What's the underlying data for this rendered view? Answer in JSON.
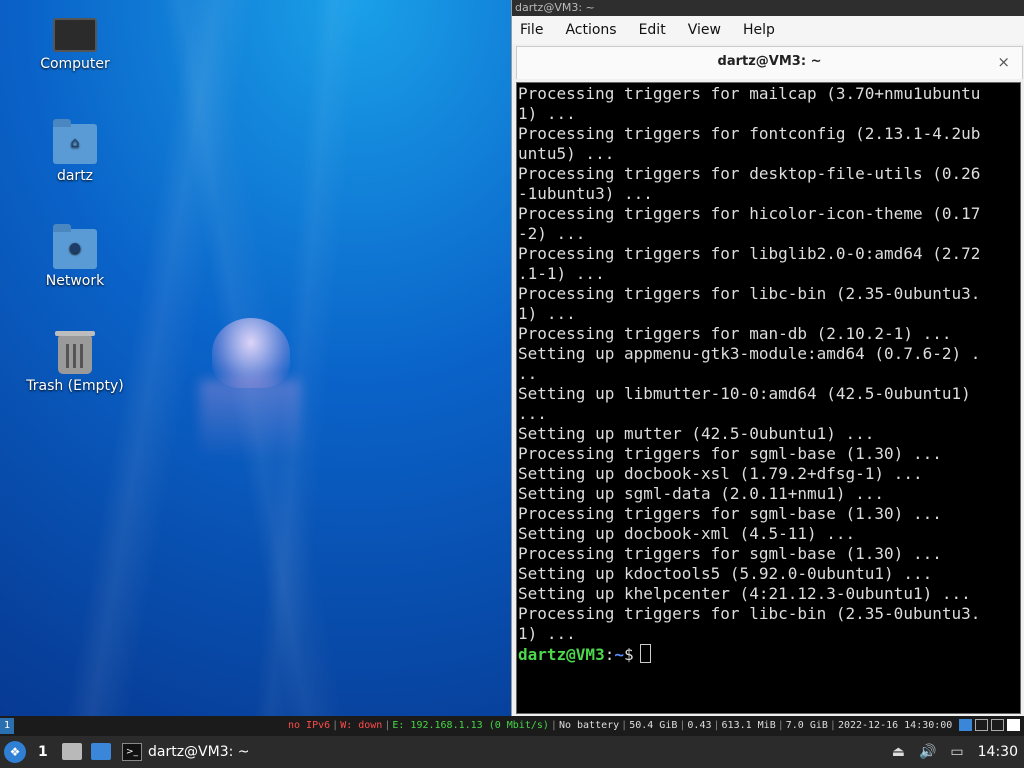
{
  "desktop": {
    "icons": [
      {
        "label": "Computer",
        "icon": "computer-icon"
      },
      {
        "label": "dartz",
        "icon": "home-folder-icon"
      },
      {
        "label": "Network",
        "icon": "network-folder-icon"
      },
      {
        "label": "Trash (Empty)",
        "icon": "trash-icon"
      }
    ]
  },
  "terminal": {
    "window_title": "dartz@VM3: ~",
    "menu": [
      "File",
      "Actions",
      "Edit",
      "View",
      "Help"
    ],
    "tab_title": "dartz@VM3: ~",
    "tab_close": "×",
    "lines": [
      "Processing triggers for mailcap (3.70+nmu1ubuntu",
      "1) ...",
      "Processing triggers for fontconfig (2.13.1-4.2ub",
      "untu5) ...",
      "Processing triggers for desktop-file-utils (0.26",
      "-1ubuntu3) ...",
      "Processing triggers for hicolor-icon-theme (0.17",
      "-2) ...",
      "Processing triggers for libglib2.0-0:amd64 (2.72",
      ".1-1) ...",
      "Processing triggers for libc-bin (2.35-0ubuntu3.",
      "1) ...",
      "Processing triggers for man-db (2.10.2-1) ...",
      "Setting up appmenu-gtk3-module:amd64 (0.7.6-2) .",
      "..",
      "Setting up libmutter-10-0:amd64 (42.5-0ubuntu1)",
      "...",
      "Setting up mutter (42.5-0ubuntu1) ...",
      "Processing triggers for sgml-base (1.30) ...",
      "Setting up docbook-xsl (1.79.2+dfsg-1) ...",
      "Setting up sgml-data (2.0.11+nmu1) ...",
      "Processing triggers for sgml-base (1.30) ...",
      "Setting up docbook-xml (4.5-11) ...",
      "Processing triggers for sgml-base (1.30) ...",
      "Setting up kdoctools5 (5.92.0-0ubuntu1) ...",
      "Setting up khelpcenter (4:21.12.3-0ubuntu1) ...",
      "Processing triggers for libc-bin (2.35-0ubuntu3.",
      "1) ..."
    ],
    "prompt": {
      "user": "dartz@VM3",
      "sep": ":",
      "path": "~",
      "symbol": "$"
    }
  },
  "statusbar": {
    "workspace": "1",
    "items": [
      {
        "text": "no IPv6",
        "color": "#ff4a4a"
      },
      {
        "text": "W: down",
        "color": "#ff4a4a"
      },
      {
        "text": "E: 192.168.1.13 (0 Mbit/s)",
        "color": "#46d646"
      },
      {
        "text": "No battery",
        "color": "#dddddd"
      },
      {
        "text": "50.4 GiB",
        "color": "#dddddd"
      },
      {
        "text": "0.43",
        "color": "#dddddd"
      },
      {
        "text": "613.1 MiB",
        "color": "#dddddd"
      },
      {
        "text": "7.0 GiB",
        "color": "#dddddd"
      },
      {
        "text": "2022-12-16 14:30:00",
        "color": "#dddddd"
      }
    ]
  },
  "taskbar": {
    "start_icon": "lubuntu-start-icon",
    "workspace": "1",
    "task_label": "dartz@VM3: ~",
    "clock": "14:30"
  }
}
